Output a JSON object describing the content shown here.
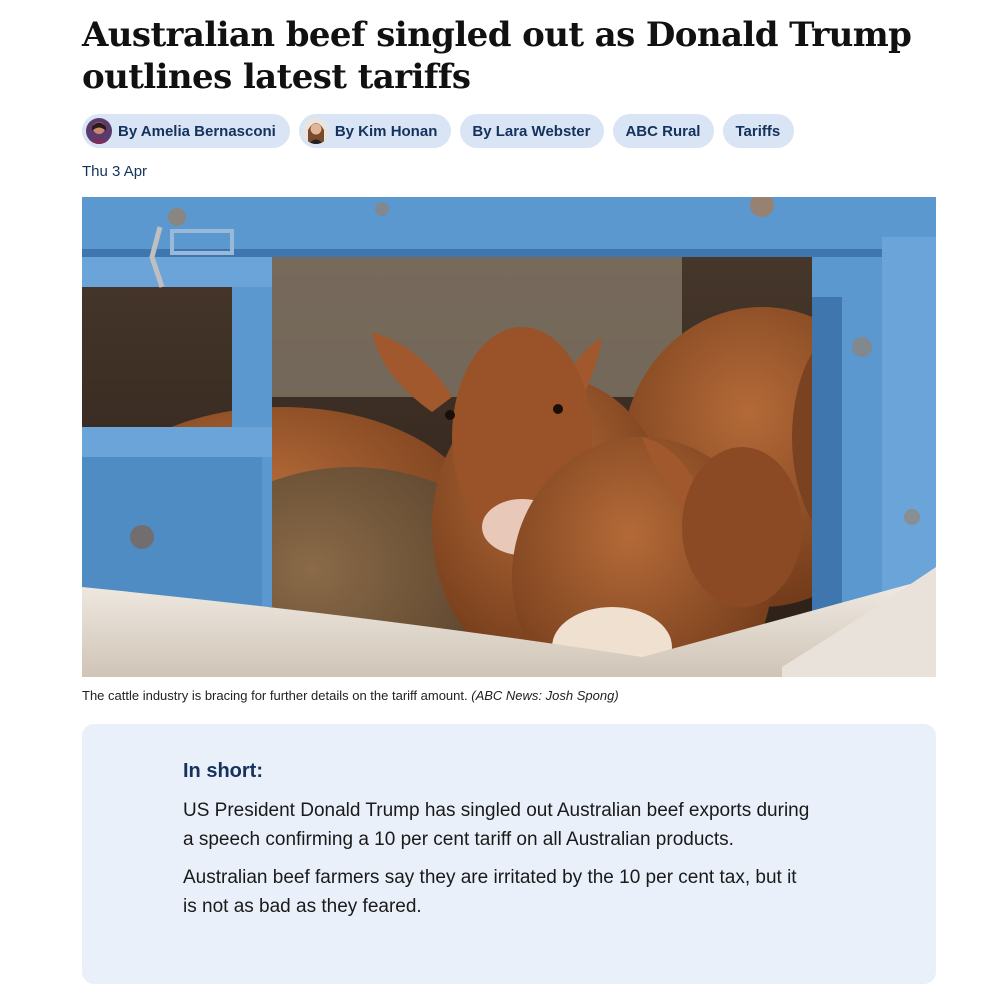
{
  "article": {
    "headline": "Australian beef singled out as Donald Trump outlines latest tariffs",
    "date": "Thu 3 Apr"
  },
  "tags": [
    {
      "label": "By Amelia Bernasconi",
      "avatar": true
    },
    {
      "label": "By Kim Honan",
      "avatar": true
    },
    {
      "label": "By Lara Webster",
      "avatar": false
    },
    {
      "label": "ABC Rural",
      "avatar": false
    },
    {
      "label": "Tariffs",
      "avatar": false
    }
  ],
  "hero_image": {
    "description_icon": "cattle-photo",
    "caption": "The cattle industry is bracing for further details on the tariff amount.",
    "credit": "(ABC News: Josh Spong)"
  },
  "in_short": {
    "heading": "In short:",
    "paragraphs": [
      "US President Donald Trump has singled out Australian beef exports during a speech confirming a 10 per cent tariff on all Australian products.",
      "Australian beef farmers say they are irritated by the 10 per cent tax, but it is not as bad as they feared."
    ]
  },
  "colors": {
    "pill_bg": "#d9e5f5",
    "pill_text": "#14325c",
    "summary_bg": "#e9f0fa",
    "truck_blue": "#5b98d0",
    "cattle_brown": "#8a4a22"
  }
}
